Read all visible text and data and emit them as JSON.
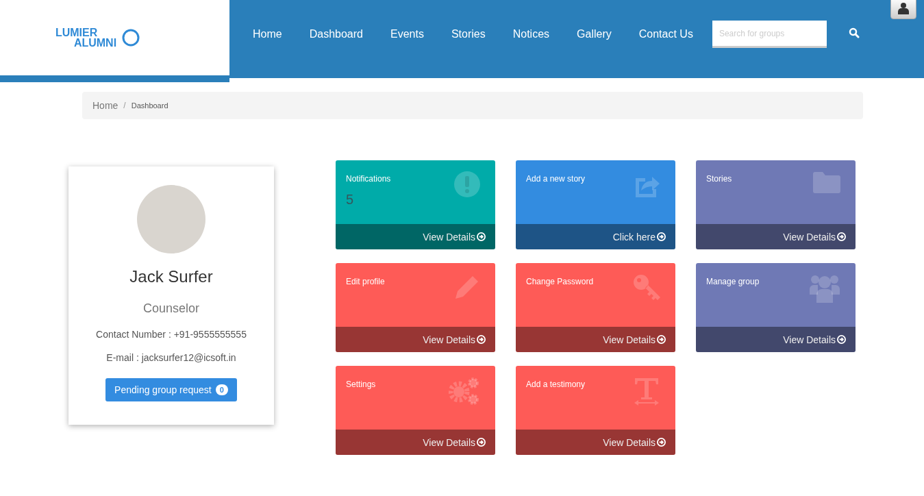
{
  "header": {
    "logo": {
      "line_1": "LUMIER",
      "line_2": "ALUMNI"
    },
    "nav": [
      {
        "label": "Home"
      },
      {
        "label": "Dashboard"
      },
      {
        "label": "Events"
      },
      {
        "label": "Stories"
      },
      {
        "label": "Notices"
      },
      {
        "label": "Gallery"
      },
      {
        "label": "Contact Us"
      }
    ],
    "search": {
      "placeholder": "Search for groups"
    }
  },
  "breadcrumb": {
    "separator": "/",
    "items": [
      {
        "label": "Home",
        "current": false
      },
      {
        "label": "Dashboard",
        "current": true
      }
    ]
  },
  "profile": {
    "name": "Jack Surfer",
    "role": "Counselor",
    "contact": "Contact Number : +91-9555555555",
    "email": "E-mail : jacksurfer12@icsoft.in",
    "button": {
      "label": "Pending group request",
      "count": "0"
    }
  },
  "tiles": [
    {
      "kind": "alert",
      "title": "Notifications",
      "value": "5",
      "link": "View Details",
      "color": "#00aba9"
    },
    {
      "kind": "share",
      "title": "Add a new story",
      "link": "Click here",
      "color": "#338ce0"
    },
    {
      "kind": "folder",
      "title": "Stories",
      "link": "View Details",
      "color": "#6f79b5"
    },
    {
      "kind": "pencil",
      "title": "Edit profile",
      "link": "View Details",
      "color": "#fe5b57"
    },
    {
      "kind": "key",
      "title": "Change Password",
      "link": "View Details",
      "color": "#fe5b57"
    },
    {
      "kind": "users",
      "title": "Manage group",
      "link": "View Details",
      "color": "#6f79b5"
    },
    {
      "kind": "gears",
      "title": "Settings",
      "link": "View Details",
      "color": "#fe5b57"
    },
    {
      "kind": "text",
      "title": "Add a testimony",
      "link": "View Details",
      "color": "#fe5b57"
    }
  ]
}
